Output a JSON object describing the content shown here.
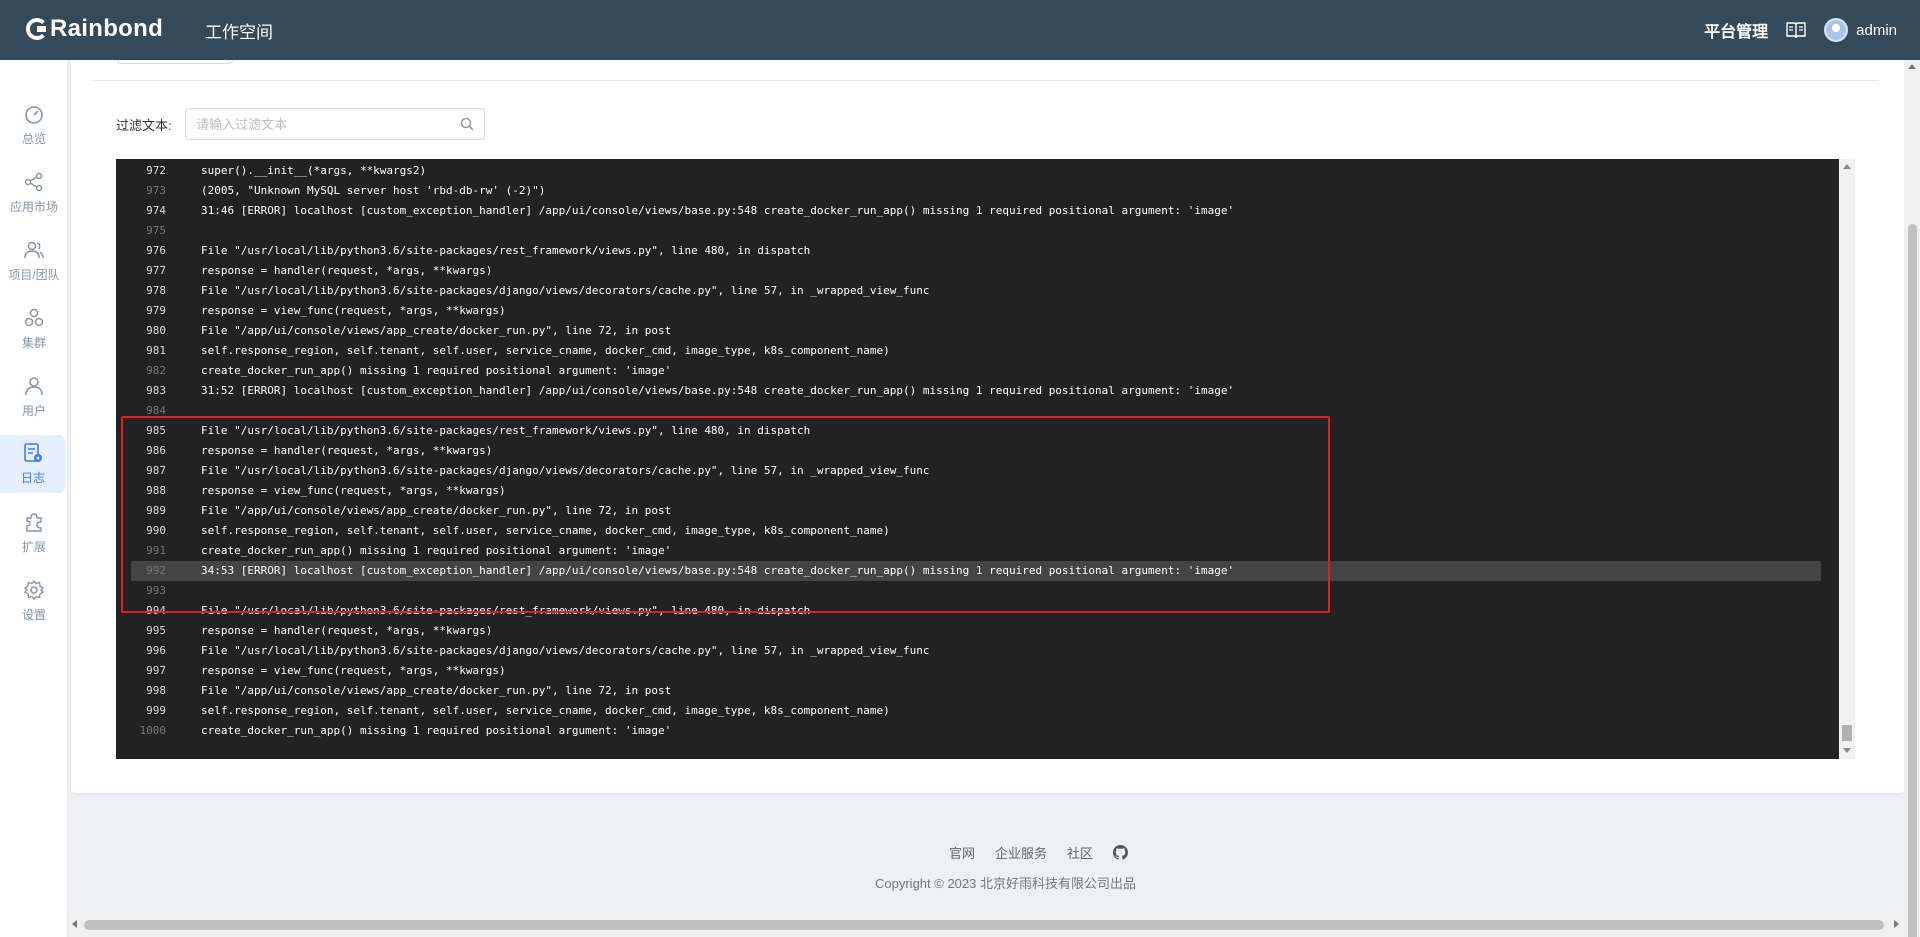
{
  "header": {
    "brand": "Rainbond",
    "workspace": "工作空间",
    "platform_admin": "平台管理",
    "user_name": "admin"
  },
  "sidebar": {
    "items": [
      {
        "label": "总览",
        "icon": "dashboard-icon"
      },
      {
        "label": "应用市场",
        "icon": "share-icon"
      },
      {
        "label": "项目/团队",
        "icon": "team-icon"
      },
      {
        "label": "集群",
        "icon": "cluster-icon"
      },
      {
        "label": "用户",
        "icon": "user-icon"
      },
      {
        "label": "日志",
        "icon": "log-icon",
        "active": true
      },
      {
        "label": "扩展",
        "icon": "puzzle-icon"
      },
      {
        "label": "设置",
        "icon": "gear-icon"
      }
    ]
  },
  "filter": {
    "label": "过滤文本:",
    "placeholder": "请输入过滤文本"
  },
  "log": {
    "lines": [
      {
        "n": "972",
        "t": "super().__init__(*args, **kwargs2)"
      },
      {
        "n": "973",
        "t": "(2005, \"Unknown MySQL server host 'rbd-db-rw' (-2)\")"
      },
      {
        "n": "974",
        "t": "31:46 [ERROR] localhost [custom_exception_handler] /app/ui/console/views/base.py:548 create_docker_run_app() missing 1 required positional argument: 'image'"
      },
      {
        "n": "975",
        "t": ""
      },
      {
        "n": "976",
        "t": "File \"/usr/local/lib/python3.6/site-packages/rest_framework/views.py\", line 480, in dispatch"
      },
      {
        "n": "977",
        "t": "response = handler(request, *args, **kwargs)"
      },
      {
        "n": "978",
        "t": "File \"/usr/local/lib/python3.6/site-packages/django/views/decorators/cache.py\", line 57, in _wrapped_view_func"
      },
      {
        "n": "979",
        "t": "response = view_func(request, *args, **kwargs)"
      },
      {
        "n": "980",
        "t": "File \"/app/ui/console/views/app_create/docker_run.py\", line 72, in post"
      },
      {
        "n": "981",
        "t": "self.response_region, self.tenant, self.user, service_cname, docker_cmd, image_type, k8s_component_name)"
      },
      {
        "n": "982",
        "t": "create_docker_run_app() missing 1 required positional argument: 'image'"
      },
      {
        "n": "983",
        "t": "31:52 [ERROR] localhost [custom_exception_handler] /app/ui/console/views/base.py:548 create_docker_run_app() missing 1 required positional argument: 'image'"
      },
      {
        "n": "984",
        "t": ""
      },
      {
        "n": "985",
        "t": "File \"/usr/local/lib/python3.6/site-packages/rest_framework/views.py\", line 480, in dispatch"
      },
      {
        "n": "986",
        "t": "response = handler(request, *args, **kwargs)"
      },
      {
        "n": "987",
        "t": "File \"/usr/local/lib/python3.6/site-packages/django/views/decorators/cache.py\", line 57, in _wrapped_view_func"
      },
      {
        "n": "988",
        "t": "response = view_func(request, *args, **kwargs)"
      },
      {
        "n": "989",
        "t": "File \"/app/ui/console/views/app_create/docker_run.py\", line 72, in post"
      },
      {
        "n": "990",
        "t": "self.response_region, self.tenant, self.user, service_cname, docker_cmd, image_type, k8s_component_name)"
      },
      {
        "n": "991",
        "t": "create_docker_run_app() missing 1 required positional argument: 'image'"
      },
      {
        "n": "992",
        "t": "34:53 [ERROR] localhost [custom_exception_handler] /app/ui/console/views/base.py:548 create_docker_run_app() missing 1 required positional argument: 'image'",
        "highlight": true
      },
      {
        "n": "993",
        "t": ""
      },
      {
        "n": "994",
        "t": "File \"/usr/local/lib/python3.6/site-packages/rest_framework/views.py\", line 480, in dispatch"
      },
      {
        "n": "995",
        "t": "response = handler(request, *args, **kwargs)"
      },
      {
        "n": "996",
        "t": "File \"/usr/local/lib/python3.6/site-packages/django/views/decorators/cache.py\", line 57, in _wrapped_view_func"
      },
      {
        "n": "997",
        "t": "response = view_func(request, *args, **kwargs)"
      },
      {
        "n": "998",
        "t": "File \"/app/ui/console/views/app_create/docker_run.py\", line 72, in post"
      },
      {
        "n": "999",
        "t": "self.response_region, self.tenant, self.user, service_cname, docker_cmd, image_type, k8s_component_name)"
      },
      {
        "n": "1000",
        "t": "create_docker_run_app() missing 1 required positional argument: 'image'"
      }
    ]
  },
  "footer": {
    "links": [
      "官网",
      "企业服务",
      "社区"
    ],
    "github_icon": "github-icon",
    "copyright": "Copyright © 2023 北京好雨科技有限公司出品"
  },
  "colors": {
    "header_bg": "#34495a",
    "log_bg": "#222222",
    "active": "#3b7bf6",
    "annotation": "#e02020"
  }
}
